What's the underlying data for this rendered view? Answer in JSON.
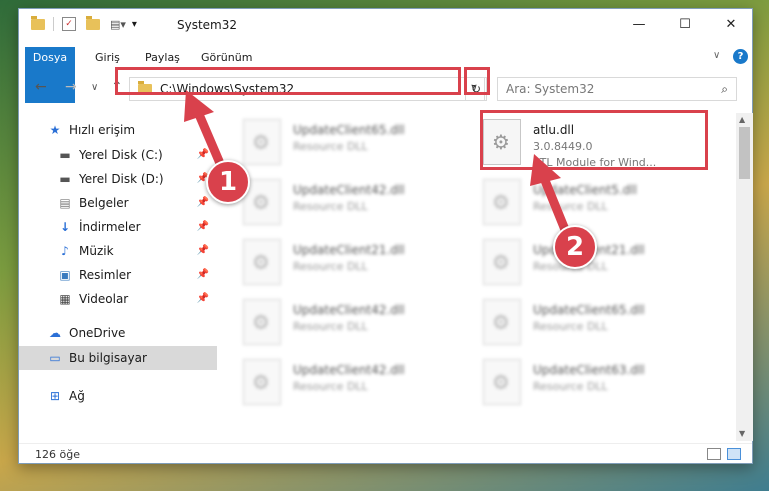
{
  "window": {
    "title": "System32",
    "controls": {
      "minimize": "—",
      "maximize": "☐",
      "close": "✕"
    }
  },
  "ribbon": {
    "tabs": [
      "Dosya",
      "Giriş",
      "Paylaş",
      "Görünüm"
    ],
    "collapse": "∨",
    "help": "?"
  },
  "navigation": {
    "back": "←",
    "forward": "→",
    "recent": "∨",
    "up": "↑",
    "address": "C:\\Windows\\System32",
    "refresh": "↻",
    "search_placeholder": "Ara: System32"
  },
  "sidebar": {
    "items": [
      {
        "label": "Hızlı erişim",
        "icon": "star-icon"
      },
      {
        "label": "Yerel Disk (C:)",
        "icon": "drive-icon",
        "pinned": true
      },
      {
        "label": "Yerel Disk (D:)",
        "icon": "drive-icon",
        "pinned": true
      },
      {
        "label": "Belgeler",
        "icon": "documents-icon",
        "pinned": true
      },
      {
        "label": "İndirmeler",
        "icon": "download-icon",
        "pinned": true
      },
      {
        "label": "Müzik",
        "icon": "music-icon",
        "pinned": true
      },
      {
        "label": "Resimler",
        "icon": "pictures-icon",
        "pinned": true
      },
      {
        "label": "Videolar",
        "icon": "video-icon",
        "pinned": true
      },
      {
        "label": "OneDrive",
        "icon": "cloud-icon"
      },
      {
        "label": "Bu bilgisayar",
        "icon": "computer-icon",
        "selected": true
      },
      {
        "label": "Ağ",
        "icon": "network-icon"
      }
    ]
  },
  "files": [
    {
      "name": "UpdateClient65.dll",
      "type": "Resource DLL",
      "blurred": true
    },
    {
      "name": "atlu.dll",
      "version": "3.0.8449.0",
      "description": "ATL Module for Wind...",
      "highlighted": true
    },
    {
      "name": "UpdateClient42.dll",
      "type": "Resource DLL",
      "blurred": true
    },
    {
      "name": "UpdateClient5.dll",
      "type": "Resource DLL",
      "blurred": true
    },
    {
      "name": "UpdateClient21.dll",
      "type": "Resource DLL",
      "blurred": true
    },
    {
      "name": "UpdateClient21.dll",
      "type": "Resource DLL",
      "blurred": true
    },
    {
      "name": "UpdateClient42.dll",
      "type": "Resource DLL",
      "blurred": true
    },
    {
      "name": "UpdateClient65.dll",
      "type": "Resource DLL",
      "blurred": true
    },
    {
      "name": "UpdateClient42.dll",
      "type": "Resource DLL",
      "blurred": true
    },
    {
      "name": "UpdateClient63.dll",
      "type": "Resource DLL",
      "blurred": true
    }
  ],
  "status": {
    "item_count": "126 öğe"
  },
  "annotations": {
    "step1": "1",
    "step2": "2",
    "color": "#d9414c"
  }
}
